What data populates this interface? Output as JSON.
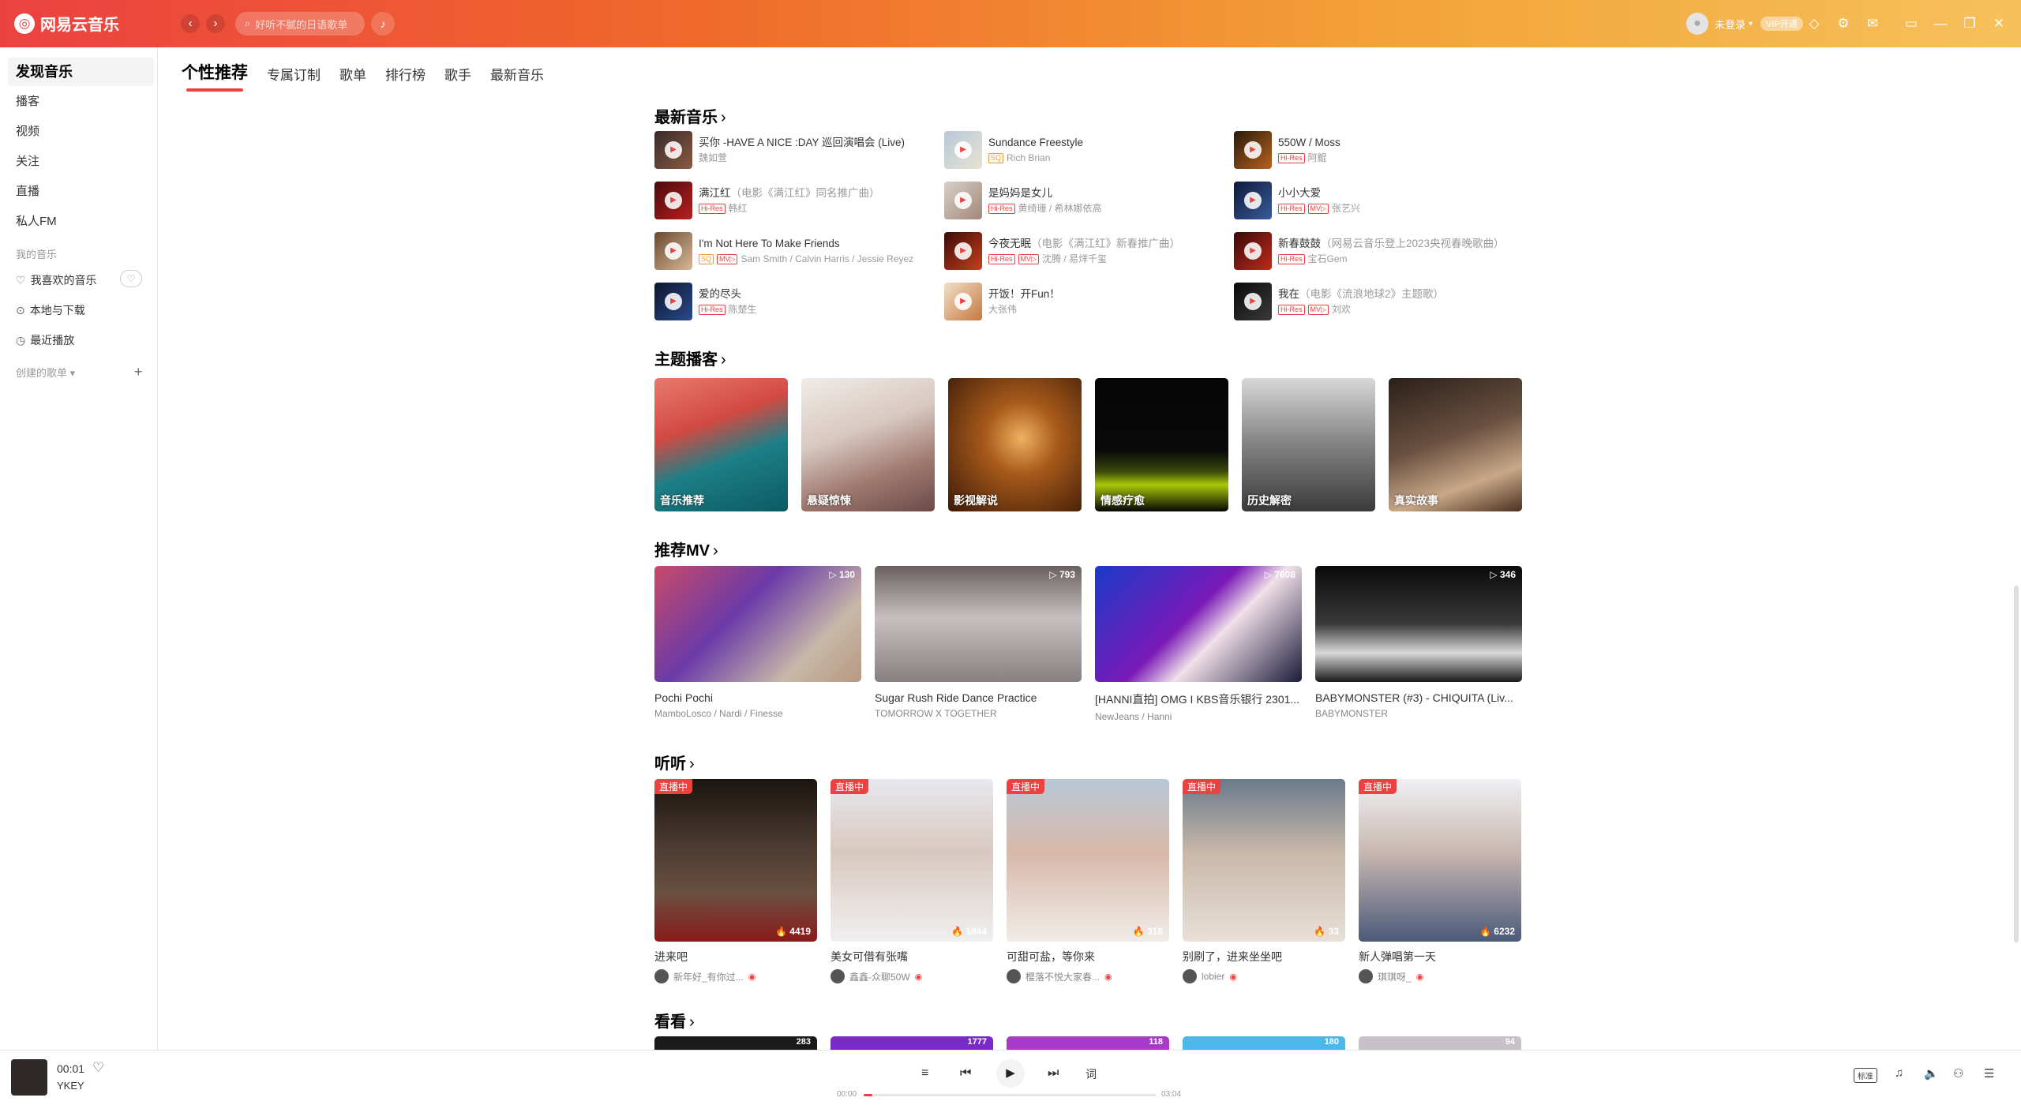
{
  "app": {
    "name": "网易云音乐",
    "search_placeholder": "好听不腻的日语歌单"
  },
  "user": {
    "name": "未登录",
    "vip_label": "VIP开通"
  },
  "sidebar": {
    "discover": "发现音乐",
    "items": [
      "播客",
      "视频",
      "关注",
      "直播",
      "私人FM"
    ],
    "my_music_label": "我的音乐",
    "my_items": [
      "我喜欢的音乐",
      "本地与下载",
      "最近播放"
    ],
    "playlists_label": "创建的歌单"
  },
  "tabs": [
    "个性推荐",
    "专属订制",
    "歌单",
    "排行榜",
    "歌手",
    "最新音乐"
  ],
  "sections": {
    "new_music": "最新音乐",
    "radio": "主题播客",
    "mv": "推荐MV",
    "listen": "听听",
    "watch": "看看"
  },
  "new_songs": [
    {
      "name": "买你 -HAVE A NICE :DAY 巡回演唱会 (Live)",
      "sub": "",
      "tags": [],
      "artist": "魏如萱"
    },
    {
      "name": "Sundance Freestyle",
      "sub": "",
      "tags": [
        "SQ"
      ],
      "artist": "Rich Brian"
    },
    {
      "name": "550W / Moss",
      "sub": "",
      "tags": [
        "Hi-Res"
      ],
      "artist": "阿鲲"
    },
    {
      "name": "满江红",
      "sub": "（电影《满江红》同名推广曲）",
      "tags": [
        "Hi-Res"
      ],
      "artist": "韩红"
    },
    {
      "name": "是妈妈是女儿",
      "sub": "",
      "tags": [
        "Hi-Res"
      ],
      "artist": "黄绮珊 / 希林娜依高"
    },
    {
      "name": "小小大爱",
      "sub": "",
      "tags": [
        "Hi-Res",
        "MV▷"
      ],
      "artist": "张艺兴"
    },
    {
      "name": "I'm Not Here To Make Friends",
      "sub": "",
      "tags": [
        "SQ",
        "MV▷"
      ],
      "artist": "Sam Smith / Calvin Harris / Jessie Reyez"
    },
    {
      "name": "今夜无眠",
      "sub": "（电影《满江红》新春推广曲）",
      "tags": [
        "Hi-Res",
        "MV▷"
      ],
      "artist": "沈腾 / 易烊千玺"
    },
    {
      "name": "新春鼓鼓",
      "sub": "（网易云音乐登上2023央视春晚歌曲）",
      "tags": [
        "Hi-Res"
      ],
      "artist": "宝石Gem"
    },
    {
      "name": "爱的尽头",
      "sub": "",
      "tags": [
        "Hi-Res"
      ],
      "artist": "陈楚生"
    },
    {
      "name": "开饭！开Fun！",
      "sub": "",
      "tags": [],
      "artist": "大张伟"
    },
    {
      "name": "我在",
      "sub": "（电影《流浪地球2》主题歌）",
      "tags": [
        "Hi-Res",
        "MV▷"
      ],
      "artist": "刘欢"
    }
  ],
  "radios": [
    "音乐推荐",
    "悬疑惊悚",
    "影视解说",
    "情感疗愈",
    "历史解密",
    "真实故事"
  ],
  "mvs": [
    {
      "count": "130",
      "title": "Pochi Pochi",
      "artist": "MamboLosco / Nardi / Finesse"
    },
    {
      "count": "793",
      "title": "Sugar Rush Ride Dance Practice",
      "artist": "TOMORROW X TOGETHER"
    },
    {
      "count": "7608",
      "title": "[HANNI直拍] OMG I KBS音乐银行 2301...",
      "artist": "NewJeans / Hanni"
    },
    {
      "count": "346",
      "title": "BABYMONSTER (#3) - CHIQUITA (Liv...",
      "artist": "BABYMONSTER"
    }
  ],
  "lives": [
    {
      "badge": "直播中",
      "heat": "4419",
      "title": "进来吧",
      "host": "新年好_有你过..."
    },
    {
      "badge": "直播中",
      "heat": "1844",
      "title": "美女可借有张嘴",
      "host": "鑫鑫-众聊50W"
    },
    {
      "badge": "直播中",
      "heat": "318",
      "title": "可甜可盐，等你来",
      "host": "樱落不悦大家春..."
    },
    {
      "badge": "直播中",
      "heat": "33",
      "title": "别刷了，进来坐坐吧",
      "host": "lobier"
    },
    {
      "badge": "直播中",
      "heat": "6232",
      "title": "新人弹唱第一天",
      "host": "琪琪呀_"
    }
  ],
  "watch_counts": [
    "283",
    "1777",
    "118",
    "180",
    "94"
  ],
  "player": {
    "time": "00:01",
    "artist": "YKEY",
    "elapsed": "00:00",
    "duration": "03:04",
    "progress": 0.03,
    "quality": "标准",
    "lyric_btn": "词"
  },
  "colors": {
    "accent": "#ec4141",
    "titlebar_start": "#ec4141",
    "titlebar_end": "#f6c15c"
  }
}
